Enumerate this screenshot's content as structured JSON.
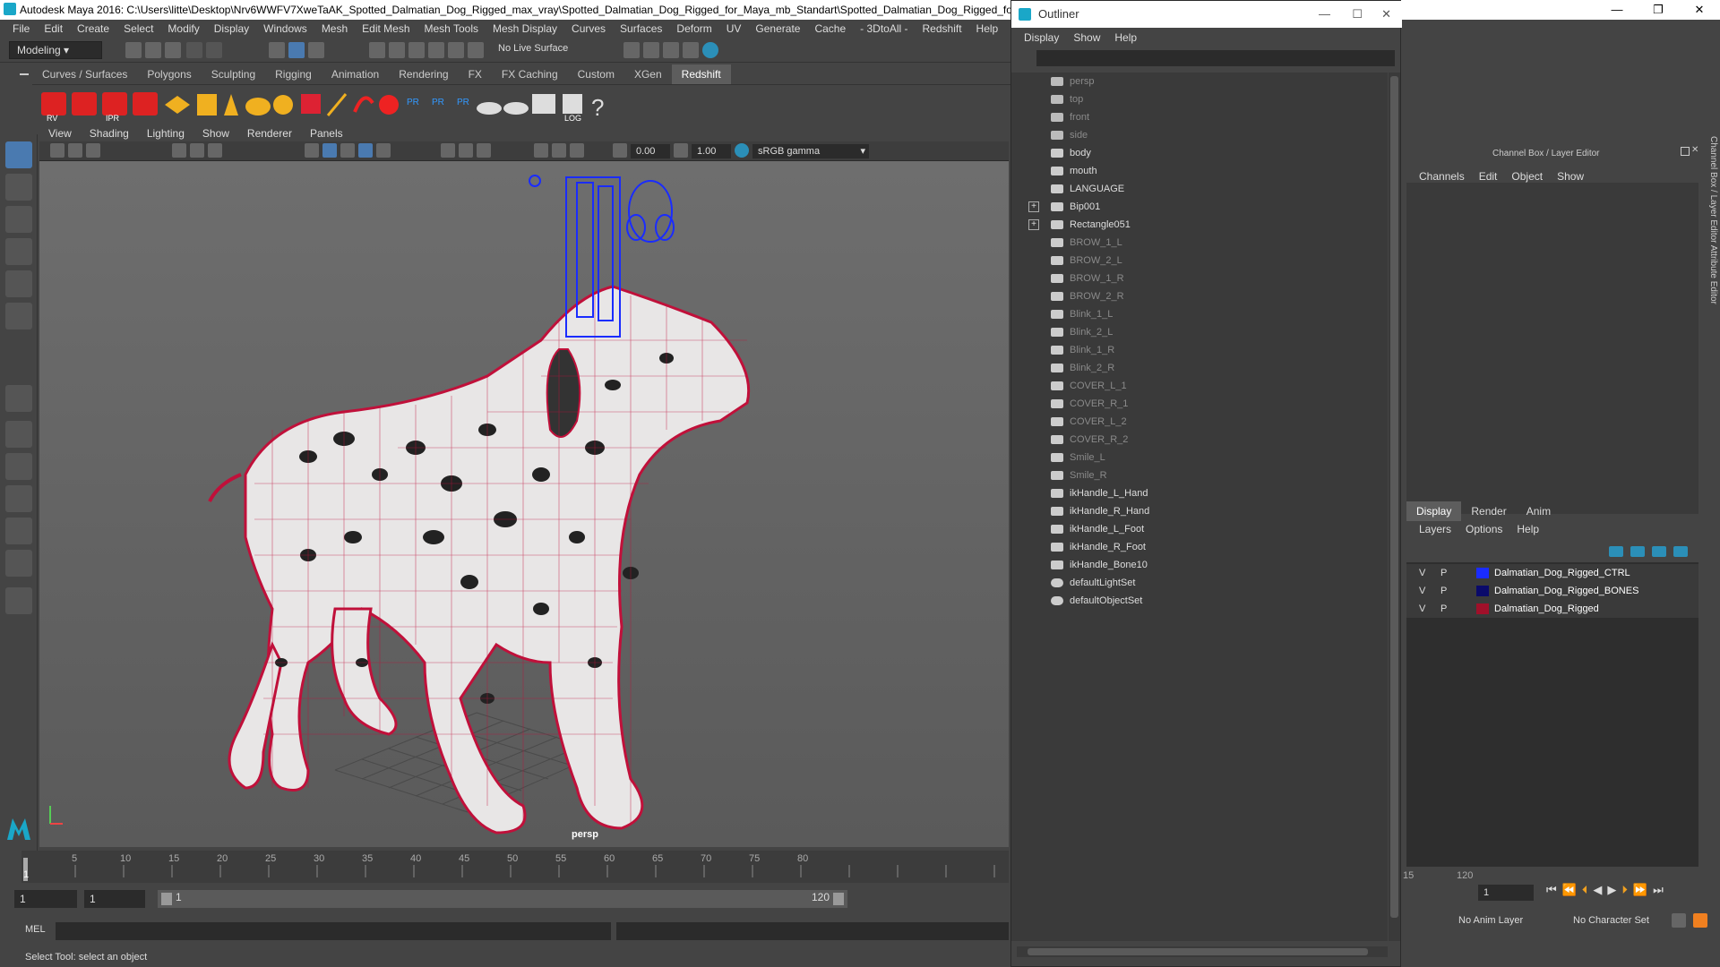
{
  "window": {
    "title": "Autodesk Maya 2016: C:\\Users\\litte\\Desktop\\Nrv6WWFV7XweTaAK_Spotted_Dalmatian_Dog_Rigged_max_vray\\Spotted_Dalmatian_Dog_Rigged_for_Maya_mb_Standart\\Spotted_Dalmatian_Dog_Rigged_for_Maya",
    "min": "—",
    "max": "❐",
    "close": "✕"
  },
  "menubar": [
    "File",
    "Edit",
    "Create",
    "Select",
    "Modify",
    "Display",
    "Windows",
    "Mesh",
    "Edit Mesh",
    "Mesh Tools",
    "Mesh Display",
    "Curves",
    "Surfaces",
    "Deform",
    "UV",
    "Generate",
    "Cache",
    "- 3DtoAll -",
    "Redshift",
    "Help"
  ],
  "status": {
    "mode": "Modeling",
    "live_surface": "No Live Surface"
  },
  "shelf_tabs": [
    "Curves / Surfaces",
    "Polygons",
    "Sculpting",
    "Rigging",
    "Animation",
    "Rendering",
    "FX",
    "FX Caching",
    "Custom",
    "XGen",
    "Redshift"
  ],
  "shelf_active": "Redshift",
  "shelf_labels": {
    "rv": "RV",
    "ipr": "IPR",
    "pr1": "PR",
    "pr2": "PR",
    "pr3": "PR",
    "log": "LOG",
    "help": "?"
  },
  "panel_menu": [
    "View",
    "Shading",
    "Lighting",
    "Show",
    "Renderer",
    "Panels"
  ],
  "panel_tools": {
    "exposure": "0.00",
    "gamma": "1.00",
    "colorspace": "sRGB gamma"
  },
  "viewport": {
    "camera_label": "persp"
  },
  "timeline": {
    "ticks": [
      "5",
      "10",
      "15",
      "20",
      "25",
      "30",
      "35",
      "40",
      "45",
      "50",
      "55",
      "60",
      "65",
      "70",
      "75",
      "80"
    ],
    "current": "1",
    "right_ticks": [
      "15",
      "120"
    ]
  },
  "range": {
    "start": "1",
    "start2": "1",
    "slider_start": "1",
    "slider_end": "120",
    "current_frame": "1",
    "anim_layer": "No Anim Layer",
    "char_set": "No Character Set"
  },
  "cmd": {
    "label": "MEL"
  },
  "helpline": "Select Tool: select an object",
  "outliner": {
    "title": "Outliner",
    "menu": [
      "Display",
      "Show",
      "Help"
    ],
    "items": [
      {
        "label": "persp",
        "type": "camera",
        "dim": true
      },
      {
        "label": "top",
        "type": "camera",
        "dim": true
      },
      {
        "label": "front",
        "type": "camera",
        "dim": true
      },
      {
        "label": "side",
        "type": "camera",
        "dim": true
      },
      {
        "label": "body",
        "type": "mesh",
        "dim": false
      },
      {
        "label": "mouth",
        "type": "mesh",
        "dim": false
      },
      {
        "label": "LANGUAGE",
        "type": "mesh",
        "dim": false
      },
      {
        "label": "Bip001",
        "type": "joint",
        "dim": false,
        "expand": true
      },
      {
        "label": "Rectangle051",
        "type": "mesh",
        "dim": false,
        "expand": true
      },
      {
        "label": "BROW_1_L",
        "type": "mesh",
        "dim": true
      },
      {
        "label": "BROW_2_L",
        "type": "mesh",
        "dim": true
      },
      {
        "label": "BROW_1_R",
        "type": "mesh",
        "dim": true
      },
      {
        "label": "BROW_2_R",
        "type": "mesh",
        "dim": true
      },
      {
        "label": "Blink_1_L",
        "type": "mesh",
        "dim": true
      },
      {
        "label": "Blink_2_L",
        "type": "mesh",
        "dim": true
      },
      {
        "label": "Blink_1_R",
        "type": "mesh",
        "dim": true
      },
      {
        "label": "Blink_2_R",
        "type": "mesh",
        "dim": true
      },
      {
        "label": "COVER_L_1",
        "type": "mesh",
        "dim": true
      },
      {
        "label": "COVER_R_1",
        "type": "mesh",
        "dim": true
      },
      {
        "label": "COVER_L_2",
        "type": "mesh",
        "dim": true
      },
      {
        "label": "COVER_R_2",
        "type": "mesh",
        "dim": true
      },
      {
        "label": "Smile_L",
        "type": "mesh",
        "dim": true
      },
      {
        "label": "Smile_R",
        "type": "mesh",
        "dim": true
      },
      {
        "label": "ikHandle_L_Hand",
        "type": "ik",
        "dim": false
      },
      {
        "label": "ikHandle_R_Hand",
        "type": "ik",
        "dim": false
      },
      {
        "label": "ikHandle_L_Foot",
        "type": "ik",
        "dim": false
      },
      {
        "label": "ikHandle_R_Foot",
        "type": "ik",
        "dim": false
      },
      {
        "label": "ikHandle_Bone10",
        "type": "ik",
        "dim": false
      },
      {
        "label": "defaultLightSet",
        "type": "set",
        "dim": false
      },
      {
        "label": "defaultObjectSet",
        "type": "set",
        "dim": false
      }
    ]
  },
  "channel_box": {
    "title": "Channel Box / Layer Editor",
    "menu": [
      "Channels",
      "Edit",
      "Object",
      "Show"
    ],
    "side_tabs": "Channel Box / Layer Editor    Attribute Editor"
  },
  "layer_editor": {
    "tabs": [
      "Display",
      "Render",
      "Anim"
    ],
    "active_tab": "Display",
    "menu": [
      "Layers",
      "Options",
      "Help"
    ],
    "layers": [
      {
        "v": "V",
        "p": "P",
        "name": "Dalmatian_Dog_Rigged_CTRL",
        "color": "#1a2cff"
      },
      {
        "v": "V",
        "p": "P",
        "name": "Dalmatian_Dog_Rigged_BONES",
        "color": "#0a0a6a"
      },
      {
        "v": "V",
        "p": "P",
        "name": "Dalmatian_Dog_Rigged",
        "color": "#a0102a"
      }
    ]
  }
}
